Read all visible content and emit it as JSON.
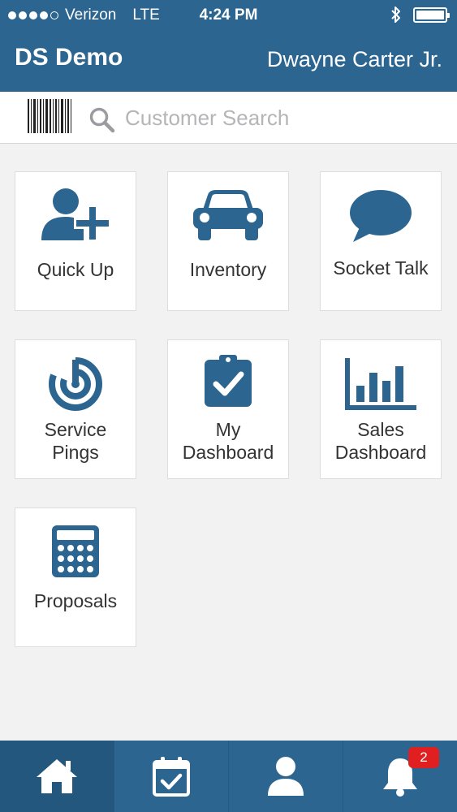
{
  "status_bar": {
    "carrier": "Verizon",
    "network": "LTE",
    "time": "4:24 PM"
  },
  "header": {
    "app_title": "DS Demo",
    "user_name": "Dwayne Carter Jr."
  },
  "search": {
    "placeholder": "Customer Search"
  },
  "tiles": [
    {
      "label": "Quick Up",
      "icon": "add-user-icon"
    },
    {
      "label": "Inventory",
      "icon": "car-icon"
    },
    {
      "label": "Socket Talk",
      "icon": "chat-bubble-icon"
    },
    {
      "label": "Service Pings",
      "icon": "radar-icon"
    },
    {
      "label": "My Dashboard",
      "icon": "clipboard-check-icon"
    },
    {
      "label": "Sales Dashboard",
      "icon": "bar-chart-icon"
    },
    {
      "label": "Proposals",
      "icon": "calculator-icon"
    }
  ],
  "bottom_nav": {
    "items": [
      {
        "icon": "home-icon"
      },
      {
        "icon": "calendar-check-icon"
      },
      {
        "icon": "person-icon"
      },
      {
        "icon": "bell-icon"
      }
    ],
    "notification_count": "2"
  },
  "colors": {
    "primary": "#2b6590",
    "icon": "#2b6590",
    "badge": "#e02020",
    "background": "#f2f2f3"
  }
}
